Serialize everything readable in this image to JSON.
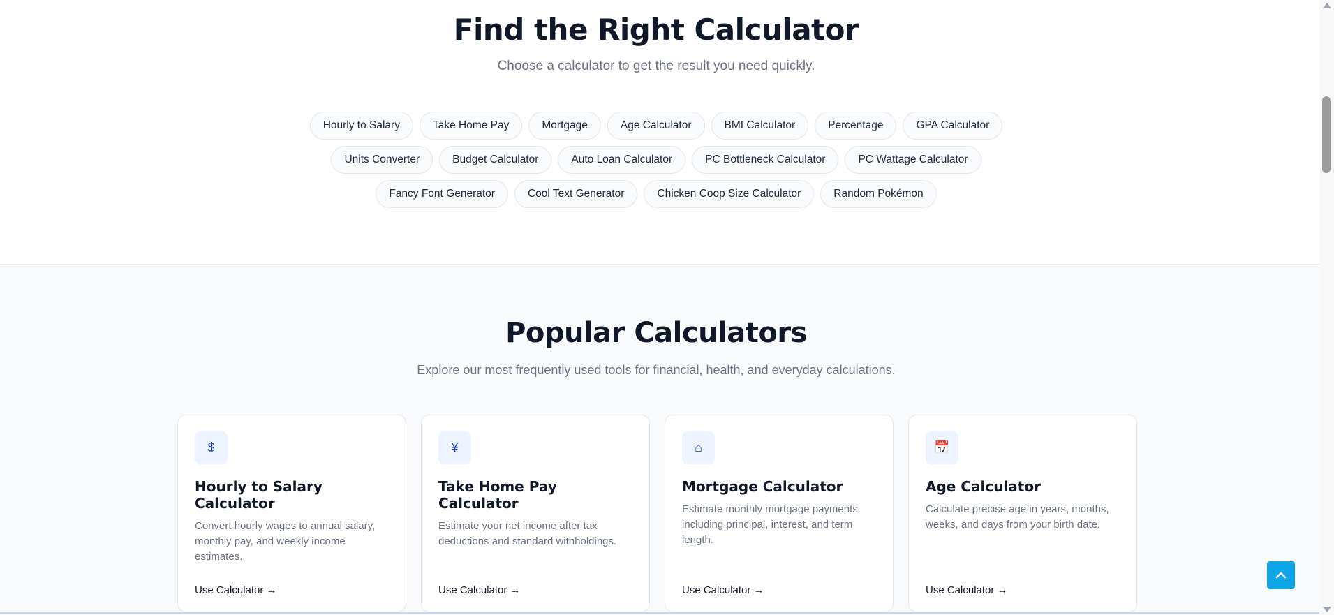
{
  "find": {
    "title": "Find the Right Calculator",
    "subtitle": "Choose a calculator to get the result you need quickly.",
    "chip_rows": [
      [
        "Hourly to Salary",
        "Take Home Pay",
        "Mortgage",
        "Age Calculator",
        "BMI Calculator",
        "Percentage",
        "GPA Calculator"
      ],
      [
        "Units Converter",
        "Budget Calculator",
        "Auto Loan Calculator",
        "PC Bottleneck Calculator",
        "PC Wattage Calculator"
      ],
      [
        "Fancy Font Generator",
        "Cool Text Generator",
        "Chicken Coop Size Calculator",
        "Random Pokémon"
      ]
    ]
  },
  "popular": {
    "title": "Popular Calculators",
    "subtitle": "Explore our most frequently used tools for financial, health, and everyday calculations.",
    "cards": [
      {
        "icon": "$",
        "icon_name": "dollar-icon",
        "title": "Hourly to Salary Calculator",
        "desc": "Convert hourly wages to annual salary, monthly pay, and weekly income estimates.",
        "link": "Use Calculator →"
      },
      {
        "icon": "¥",
        "icon_name": "yen-icon",
        "title": "Take Home Pay Calculator",
        "desc": "Estimate your net income after tax deductions and standard withholdings.",
        "link": "Use Calculator →"
      },
      {
        "icon": "⌂",
        "icon_name": "house-icon",
        "title": "Mortgage Calculator",
        "desc": "Estimate monthly mortgage payments including principal, interest, and term length.",
        "link": "Use Calculator →"
      },
      {
        "icon": "📅",
        "icon_name": "calendar-icon",
        "title": "Age Calculator",
        "desc": "Calculate precise age in years, months, weeks, and days from your birth date.",
        "link": "Use Calculator →"
      }
    ]
  },
  "colors": {
    "accent": "#0ea5e9",
    "heading": "#111827",
    "muted": "#6b7280",
    "chip_bg": "#f8fafc"
  }
}
